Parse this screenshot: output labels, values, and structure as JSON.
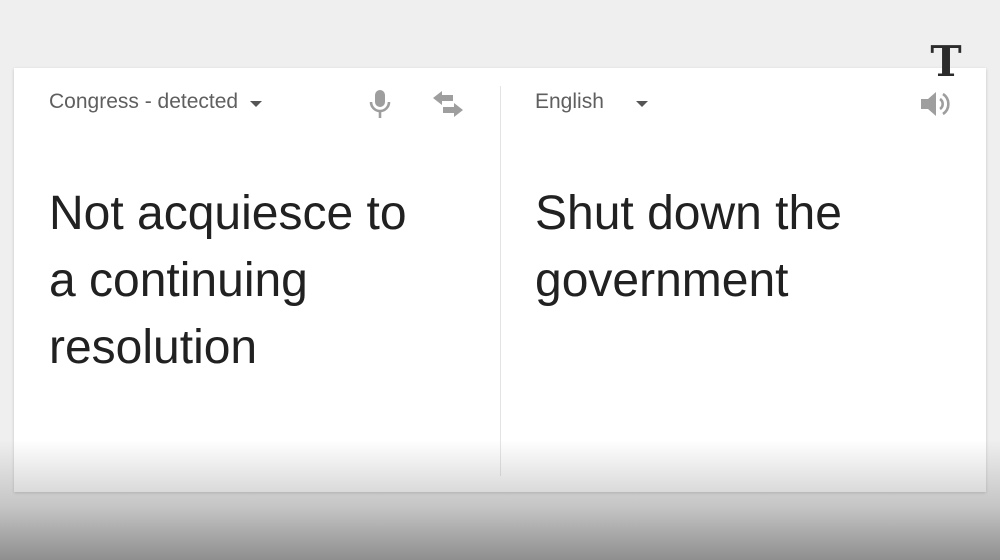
{
  "source": {
    "language_label": "Congress - detected",
    "text_lines": [
      "Not acquiesce to",
      "a continuing",
      "resolution"
    ],
    "icons": [
      "microphone-icon",
      "swap-languages-icon",
      "chevron-down-icon"
    ]
  },
  "target": {
    "language_label": "English",
    "text_lines": [
      "Shut down the",
      "government"
    ],
    "icons": [
      "speaker-icon",
      "chevron-down-icon"
    ]
  },
  "watermark": {
    "text": "T",
    "icon": "nyt-logo-icon"
  },
  "colors": {
    "background": "#efefef",
    "card": "#ffffff",
    "label": "#5f5f5f",
    "text": "#212121",
    "icon": "#9e9e9e"
  }
}
